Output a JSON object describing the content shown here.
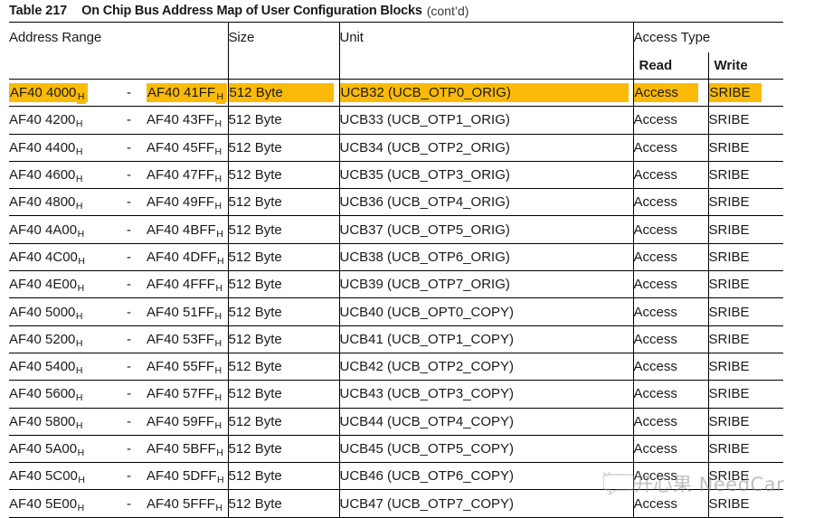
{
  "caption": {
    "number": "Table 217",
    "title": "On Chip Bus Address Map of User Configuration Blocks",
    "continued": "(cont’d)"
  },
  "table": {
    "headers": {
      "address_range": "Address Range",
      "size": "Size",
      "unit": "Unit",
      "access_type": "Access Type",
      "read": "Read",
      "write": "Write"
    },
    "colors": {
      "highlight": "#fbba07",
      "border": "#000000",
      "text": "#1a1a1a"
    },
    "hex_suffix": "H",
    "dash": "-",
    "rows": [
      {
        "start": "AF40 4000",
        "end": "AF40 41FF",
        "size": "512 Byte",
        "unit": "UCB32 (UCB_OTP0_ORIG)",
        "read": "Access",
        "write": "SRIBE",
        "highlight": true
      },
      {
        "start": "AF40 4200",
        "end": "AF40 43FF",
        "size": "512 Byte",
        "unit": "UCB33 (UCB_OTP1_ORIG)",
        "read": "Access",
        "write": "SRIBE",
        "highlight": false
      },
      {
        "start": "AF40 4400",
        "end": "AF40 45FF",
        "size": "512 Byte",
        "unit": "UCB34 (UCB_OTP2_ORIG)",
        "read": "Access",
        "write": "SRIBE",
        "highlight": false
      },
      {
        "start": "AF40 4600",
        "end": "AF40 47FF",
        "size": "512 Byte",
        "unit": "UCB35 (UCB_OTP3_ORIG)",
        "read": "Access",
        "write": "SRIBE",
        "highlight": false
      },
      {
        "start": "AF40 4800",
        "end": "AF40 49FF",
        "size": "512 Byte",
        "unit": "UCB36 (UCB_OTP4_ORIG)",
        "read": "Access",
        "write": "SRIBE",
        "highlight": false
      },
      {
        "start": "AF40 4A00",
        "end": "AF40 4BFF",
        "size": "512 Byte",
        "unit": "UCB37 (UCB_OTP5_ORIG)",
        "read": "Access",
        "write": "SRIBE",
        "highlight": false
      },
      {
        "start": "AF40 4C00",
        "end": "AF40 4DFF",
        "size": "512 Byte",
        "unit": "UCB38 (UCB_OTP6_ORIG)",
        "read": "Access",
        "write": "SRIBE",
        "highlight": false
      },
      {
        "start": "AF40 4E00",
        "end": "AF40 4FFF",
        "size": "512 Byte",
        "unit": "UCB39 (UCB_OTP7_ORIG)",
        "read": "Access",
        "write": "SRIBE",
        "highlight": false
      },
      {
        "start": "AF40 5000",
        "end": "AF40 51FF",
        "size": "512 Byte",
        "unit": "UCB40 (UCB_OPT0_COPY)",
        "read": "Access",
        "write": "SRIBE",
        "highlight": false
      },
      {
        "start": "AF40 5200",
        "end": "AF40 53FF",
        "size": "512 Byte",
        "unit": "UCB41 (UCB_OTP1_COPY)",
        "read": "Access",
        "write": "SRIBE",
        "highlight": false
      },
      {
        "start": "AF40 5400",
        "end": "AF40 55FF",
        "size": "512 Byte",
        "unit": "UCB42 (UCB_OTP2_COPY)",
        "read": "Access",
        "write": "SRIBE",
        "highlight": false
      },
      {
        "start": "AF40 5600",
        "end": "AF40 57FF",
        "size": "512 Byte",
        "unit": "UCB43 (UCB_OTP3_COPY)",
        "read": "Access",
        "write": "SRIBE",
        "highlight": false
      },
      {
        "start": "AF40 5800",
        "end": "AF40 59FF",
        "size": "512 Byte",
        "unit": "UCB44 (UCB_OTP4_COPY)",
        "read": "Access",
        "write": "SRIBE",
        "highlight": false
      },
      {
        "start": "AF40 5A00",
        "end": "AF40 5BFF",
        "size": "512 Byte",
        "unit": "UCB45 (UCB_OTP5_COPY)",
        "read": "Access",
        "write": "SRIBE",
        "highlight": false
      },
      {
        "start": "AF40 5C00",
        "end": "AF40 5DFF",
        "size": "512 Byte",
        "unit": "UCB46 (UCB_OTP6_COPY)",
        "read": "Access",
        "write": "SRIBE",
        "highlight": false
      },
      {
        "start": "AF40 5E00",
        "end": "AF40 5FFF",
        "size": "512 Byte",
        "unit": "UCB47 (UCB_OTP7_COPY)",
        "read": "Access",
        "write": "SRIBE",
        "highlight": false
      }
    ]
  },
  "watermark": {
    "text": "开心果 NeedCar",
    "icon": "chat-bubble-icon"
  }
}
